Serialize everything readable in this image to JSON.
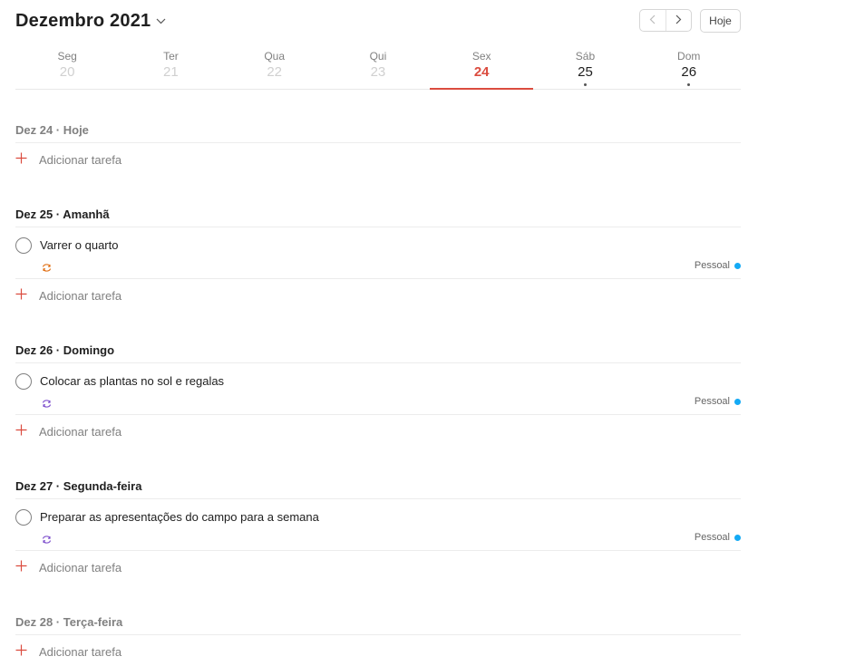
{
  "header": {
    "month_title": "Dezembro 2021",
    "today_button": "Hoje"
  },
  "week": [
    {
      "name": "Seg",
      "num": "20"
    },
    {
      "name": "Ter",
      "num": "21"
    },
    {
      "name": "Qua",
      "num": "22"
    },
    {
      "name": "Qui",
      "num": "23"
    },
    {
      "name": "Sex",
      "num": "24"
    },
    {
      "name": "Sáb",
      "num": "25"
    },
    {
      "name": "Dom",
      "num": "26"
    }
  ],
  "sections": [
    {
      "heading": "Dez 24 · Hoje",
      "add_label": "Adicionar tarefa"
    },
    {
      "heading": "Dez 25 · Amanhã",
      "task": "Varrer o quarto",
      "project": "Pessoal",
      "add_label": "Adicionar tarefa"
    },
    {
      "heading": "Dez 26 · Domingo",
      "task": "Colocar as plantas no sol e regalas",
      "project": "Pessoal",
      "add_label": "Adicionar tarefa"
    },
    {
      "heading": "Dez 27 · Segunda-feira",
      "task": "Preparar as apresentações do campo para a semana",
      "project": "Pessoal",
      "add_label": "Adicionar tarefa"
    },
    {
      "heading": "Dez 28 · Terça-feira",
      "add_label": "Adicionar tarefa"
    }
  ],
  "colors": {
    "accent": "#db4c3f",
    "project_dot": "#14aaf5",
    "recur_orange": "#e06d10",
    "recur_purple": "#7c4dcc"
  },
  "icons": {
    "month_dropdown": "chevron-down-icon",
    "prev": "chevron-left-icon",
    "next": "chevron-right-icon",
    "add": "plus-icon",
    "recurring": "recurring-icon",
    "complete": "circle-checkbox-icon"
  }
}
